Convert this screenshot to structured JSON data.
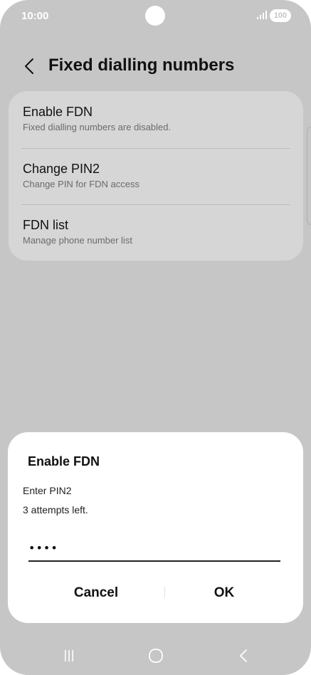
{
  "status_bar": {
    "time": "10:00",
    "battery": "100"
  },
  "header": {
    "title": "Fixed dialling numbers"
  },
  "settings": {
    "items": [
      {
        "title": "Enable FDN",
        "subtitle": "Fixed dialling numbers are disabled."
      },
      {
        "title": "Change PIN2",
        "subtitle": "Change PIN for FDN access"
      },
      {
        "title": "FDN list",
        "subtitle": "Manage phone number list"
      }
    ]
  },
  "dialog": {
    "title": "Enable FDN",
    "message_line1": "Enter PIN2",
    "message_line2": "3 attempts left.",
    "pin_value": "••••",
    "cancel_label": "Cancel",
    "ok_label": "OK"
  },
  "nav_icons": [
    "recents-icon",
    "home-icon",
    "back-icon"
  ],
  "colors": {
    "background": "#c6c6c6",
    "card": "#d6d6d6",
    "dialog": "#ffffff",
    "text_primary": "#111111",
    "text_secondary": "#6b6b6b"
  }
}
